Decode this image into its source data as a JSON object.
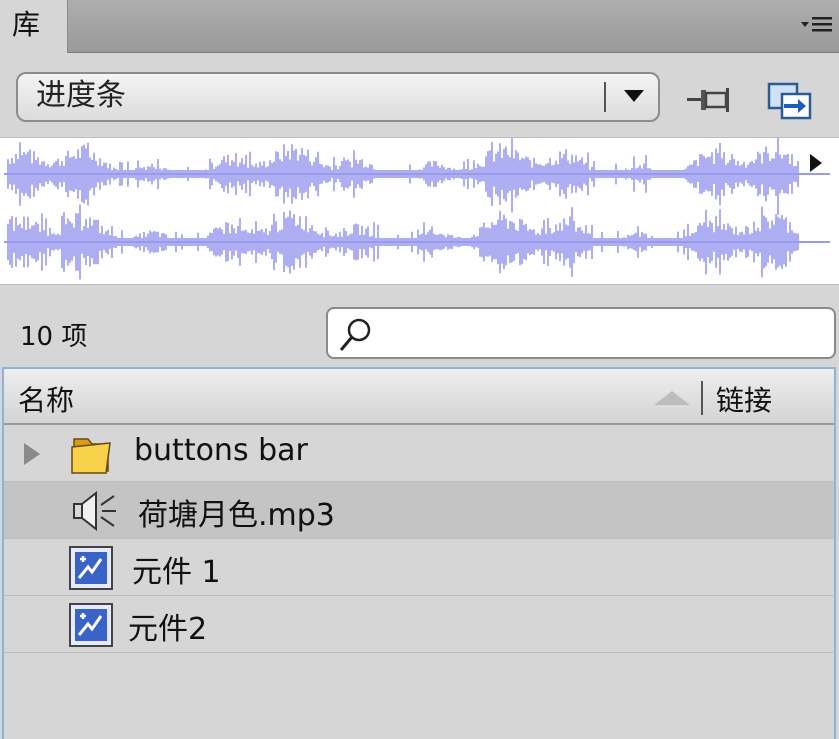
{
  "panel": {
    "tab_label": "库",
    "menu_icon": "panel-menu-icon"
  },
  "toolbar": {
    "document_select": "进度条",
    "pin_icon": "pin-icon",
    "import_icon": "new-library-icon"
  },
  "preview": {
    "type": "audio-waveform",
    "color": "#9999ee",
    "play_icon": "play-icon"
  },
  "items_count": "10 项",
  "search": {
    "value": "",
    "placeholder": ""
  },
  "columns": {
    "name": "名称",
    "linkage": "链接"
  },
  "rows": [
    {
      "label": "buttons bar",
      "icon": "folder-icon",
      "expandable": true,
      "selected": false
    },
    {
      "label": "荷塘月色.mp3",
      "icon": "sound-icon",
      "expandable": false,
      "selected": true
    },
    {
      "label": "元件 1",
      "icon": "graphic-symbol-icon",
      "expandable": false,
      "selected": false
    },
    {
      "label": "元件2",
      "icon": "graphic-symbol-icon",
      "expandable": false,
      "selected": false
    }
  ],
  "colors": {
    "panel_bg": "#d6d6d6",
    "waveform": "#9999ee",
    "list_border": "#8fb2d6",
    "selected_row": "#c4c4c4"
  }
}
